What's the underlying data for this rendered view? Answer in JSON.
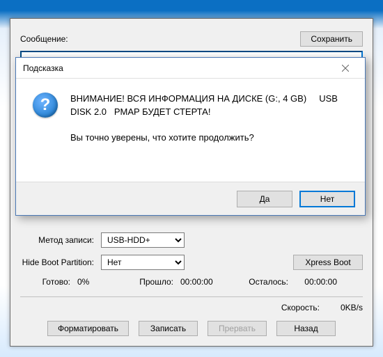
{
  "main": {
    "message_label": "Сообщение:",
    "save_button": "Сохранить",
    "write_method_label": "Метод записи:",
    "write_method_value": "USB-HDD+",
    "hide_boot_label": "Hide Boot Partition:",
    "hide_boot_value": "Нет",
    "xpress_boot_button": "Xpress Boot",
    "ready_label": "Готово:",
    "ready_value": "0%",
    "elapsed_label": "Прошло:",
    "elapsed_value": "00:00:00",
    "remaining_label": "Осталось:",
    "remaining_value": "00:00:00",
    "speed_label": "Скорость:",
    "speed_value": "0KB/s",
    "format_button": "Форматировать",
    "write_button": "Записать",
    "abort_button": "Прервать",
    "back_button": "Назад"
  },
  "dialog": {
    "title": "Подсказка",
    "warning_text": "ВНИМАНИЕ! ВСЯ ИНФОРМАЦИЯ НА ДИСКЕ (G:, 4 GB)     USB DISK 2.0   PMAP БУДЕТ СТЕРТА!",
    "confirm_text": "Вы точно уверены, что хотите продолжить?",
    "yes_button": "Да",
    "no_button": "Нет"
  }
}
